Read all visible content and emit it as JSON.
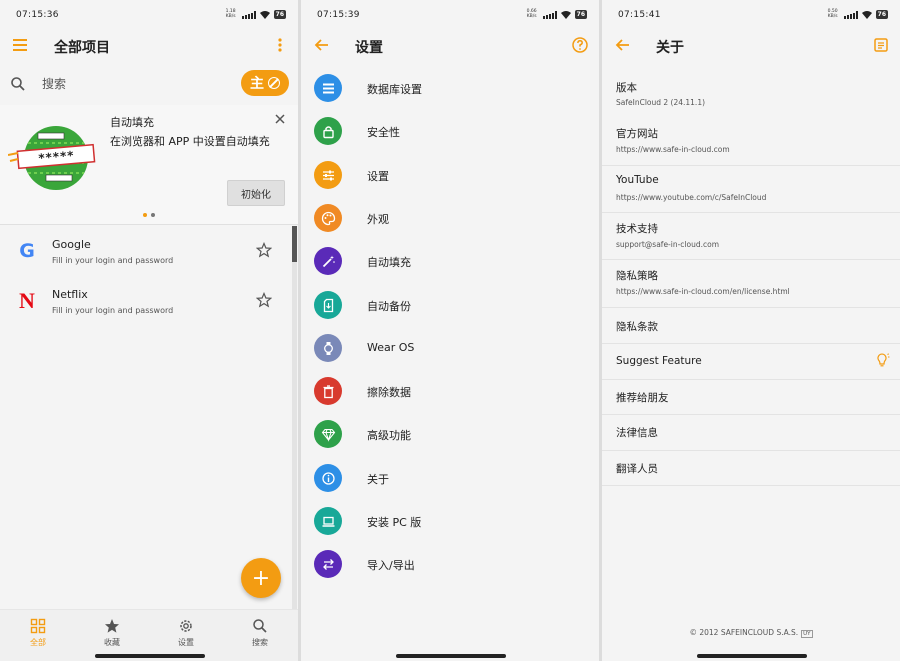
{
  "colors": {
    "accent": "#f39c12",
    "db_settings": "#2d8fe6",
    "security": "#2ea14a",
    "settings": "#f39c12",
    "appearance": "#f08a24",
    "autofill": "#5a2ab8",
    "autobackup": "#18a898",
    "wearos": "#7a89b8",
    "erase": "#d83a2e",
    "premium": "#2ea14a",
    "about": "#2d8fe6",
    "install_pc": "#18a898",
    "import_export": "#5a2ab8"
  },
  "panel1": {
    "status": {
      "time": "07:15:36",
      "net": "1.18 KB/s",
      "battery": "76"
    },
    "title": "全部项目",
    "search_placeholder": "搜索",
    "filter_label": "主",
    "banner": {
      "title": "自动填充",
      "description": "在浏览器和 APP 中设置自动填充",
      "init_button": "初始化",
      "art_text": "*****"
    },
    "entries": [
      {
        "name": "Google",
        "subtitle": "Fill in your login and password",
        "logo": "G"
      },
      {
        "name": "Netflix",
        "subtitle": "Fill in your login and password",
        "logo": "N"
      }
    ],
    "fab_icon": "+",
    "bottom_nav": [
      {
        "label": "全部",
        "icon": "grid-icon",
        "active": true
      },
      {
        "label": "收藏",
        "icon": "star-icon",
        "active": false
      },
      {
        "label": "设置",
        "icon": "gear-icon",
        "active": false
      },
      {
        "label": "搜索",
        "icon": "search-icon",
        "active": false
      }
    ]
  },
  "panel2": {
    "status": {
      "time": "07:15:39",
      "net": "0.66 KB/s",
      "battery": "76"
    },
    "title": "设置",
    "items": [
      {
        "label": "数据库设置",
        "icon": "list-icon"
      },
      {
        "label": "安全性",
        "icon": "lock-icon"
      },
      {
        "label": "设置",
        "icon": "sliders-icon"
      },
      {
        "label": "外观",
        "icon": "palette-icon"
      },
      {
        "label": "自动填充",
        "icon": "magic-wand-icon"
      },
      {
        "label": "自动备份",
        "icon": "sd-card-icon"
      },
      {
        "label": "Wear OS",
        "icon": "watch-icon"
      },
      {
        "label": "擦除数据",
        "icon": "trash-icon"
      },
      {
        "label": "高级功能",
        "icon": "diamond-icon"
      },
      {
        "label": "关于",
        "icon": "info-icon"
      },
      {
        "label": "安装 PC 版",
        "icon": "laptop-icon"
      },
      {
        "label": "导入/导出",
        "icon": "swap-icon"
      }
    ]
  },
  "panel3": {
    "status": {
      "time": "07:15:41",
      "net": "0.50 KB/s",
      "battery": "76"
    },
    "title": "关于",
    "items": [
      {
        "title": "版本",
        "subtitle": "SafeInCloud 2 (24.11.1)"
      },
      {
        "title": "官方网站",
        "subtitle": "https://www.safe-in-cloud.com"
      },
      {
        "title": "YouTube",
        "subtitle": "https://www.youtube.com/c/SafeInCloud"
      },
      {
        "title": "技术支持",
        "subtitle": "support@safe-in-cloud.com"
      },
      {
        "title": "隐私策略",
        "subtitle": "https://www.safe-in-cloud.com/en/license.html"
      },
      {
        "title": "隐私条款",
        "subtitle": ""
      },
      {
        "title": "Suggest Feature",
        "subtitle": ""
      },
      {
        "title": "推荐给朋友",
        "subtitle": ""
      },
      {
        "title": "法律信息",
        "subtitle": ""
      },
      {
        "title": "翻译人员",
        "subtitle": ""
      }
    ],
    "copyright": "© 2012 SAFEINCLOUD S.A.S.",
    "copyright_badge": "UY"
  }
}
